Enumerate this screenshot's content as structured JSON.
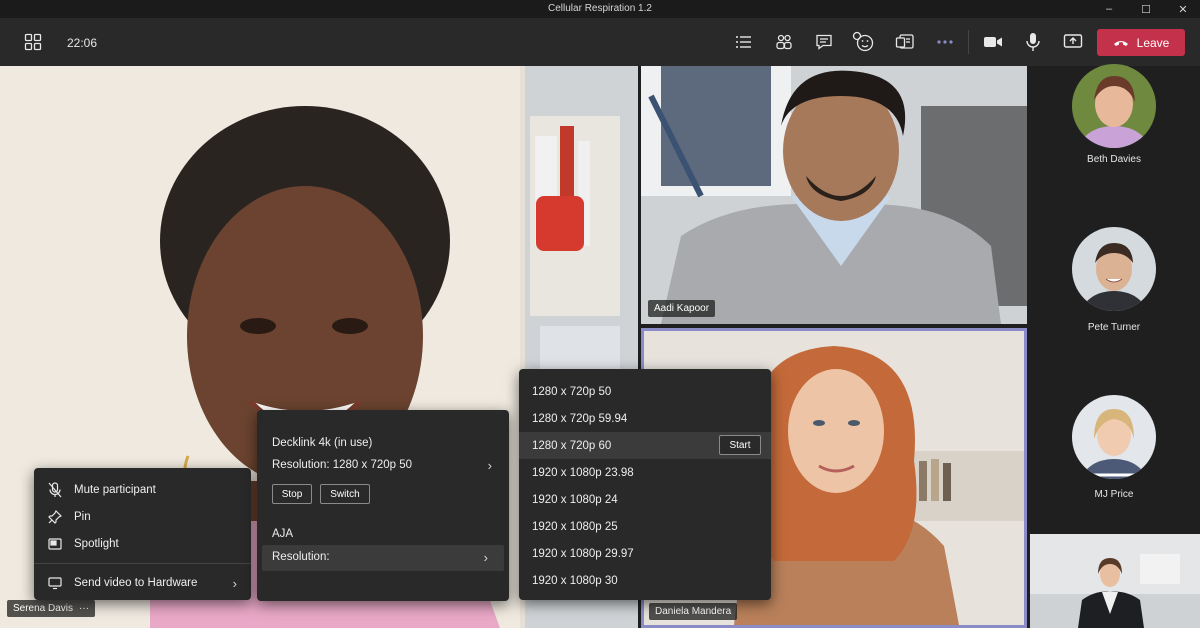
{
  "window": {
    "title": "Cellular Respiration 1.2",
    "minimize": "–",
    "maximize": "☐",
    "close": "✕"
  },
  "toolbar": {
    "time": "22:06",
    "leave_label": "Leave"
  },
  "participants": {
    "main": {
      "name": "Serena Davis",
      "more": "···"
    },
    "aadi": {
      "name": "Aadi Kapoor"
    },
    "daniela": {
      "name": "Daniela Mandera"
    },
    "side": [
      {
        "name": "Beth Davies"
      },
      {
        "name": "Pete Turner"
      },
      {
        "name": "MJ Price"
      }
    ]
  },
  "context_menu": {
    "items": [
      {
        "label": "Mute participant",
        "icon": "mic-off-icon"
      },
      {
        "label": "Pin",
        "icon": "pin-icon"
      },
      {
        "label": "Spotlight",
        "icon": "spotlight-icon"
      },
      {
        "label": "Send video to Hardware",
        "icon": "monitor-icon"
      }
    ]
  },
  "hardware_menu": {
    "device1": "Decklink 4k (in use)",
    "resolution1": "Resolution:  1280 x 720p 50",
    "stop": "Stop",
    "switch": "Switch",
    "device2": "AJA",
    "resolution2": "Resolution:"
  },
  "resolution_menu": {
    "options": [
      "1280 x 720p 50",
      "1280 x 720p 59.94",
      "1280 x 720p 60",
      "1920 x 1080p 23.98",
      "1920 x 1080p 24",
      "1920 x 1080p 25",
      "1920 x 1080p 29.97",
      "1920 x 1080p 30"
    ],
    "start": "Start"
  },
  "colors": {
    "leave": "#c4314b",
    "accent": "#8b8cc7"
  }
}
